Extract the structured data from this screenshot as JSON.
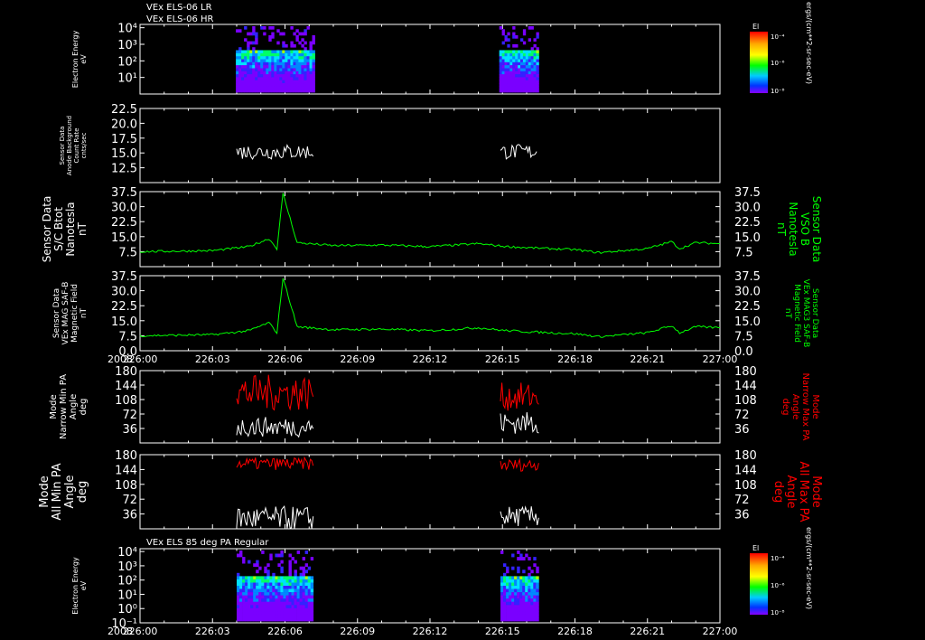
{
  "header": {
    "line1": "VEx ELS-06 LR",
    "line2": "VEx ELS-06 HR",
    "bottom_title": "VEx ELS 85 deg PA Regular"
  },
  "colors": {
    "background": "#000000",
    "axis": "#ffffff",
    "green": "#00ff00",
    "red": "#ff0000"
  },
  "colorbars": [
    {
      "title": "El",
      "ticks": [
        "10⁻⁴",
        "10⁻⁶",
        "10⁻⁸"
      ],
      "unit_label": "ergs/(cm**2-sr-sec-eV)"
    },
    {
      "title": "El",
      "ticks": [
        "10⁻⁴",
        "10⁻⁶",
        "10⁻⁸"
      ],
      "unit_label": "ergs/(cm**2-sr-sec-eV)"
    }
  ],
  "chart_data": [
    {
      "type": "heatmap",
      "ylabel": [
        "Electron Energy",
        "eV"
      ],
      "ytick_labels": [
        "10⁴",
        "10³",
        "10²",
        "10¹"
      ],
      "ylim_log10": [
        0,
        4.2
      ],
      "data_blocks": [
        {
          "x_start": "226:03:58",
          "x_end": "226:07:14"
        },
        {
          "x_start": "226:14:52",
          "x_end": "226:16:30"
        }
      ],
      "zscale": "log"
    },
    {
      "type": "line",
      "ylabel": [
        "Sensor Data",
        "Anode Background",
        "Count Rate",
        "cnts/sec"
      ],
      "ylim": [
        10,
        22.5
      ],
      "yticks": [
        12.5,
        15.0,
        17.5,
        20.0,
        22.5
      ],
      "ytick_labels": [
        "12.5",
        "15.0",
        "17.5",
        "20.0",
        "22.5"
      ],
      "series": [
        {
          "segments": [
            {
              "x_start": "226:04:00",
              "x_end": "226:07:10",
              "level": 15.2,
              "spread": 1.3
            },
            {
              "x_start": "226:14:55",
              "x_end": "226:16:25",
              "level": 15.2,
              "spread": 1.3
            }
          ]
        }
      ]
    },
    {
      "type": "line",
      "ylabel_left": [
        "Sensor Data",
        "S/C Btot",
        "Nanotesla",
        "nT"
      ],
      "ylabel_right": [
        "Sensor Data",
        "VSO B",
        "Nanotesla",
        "nT"
      ],
      "ylim": [
        0,
        37.5
      ],
      "yticks": [
        7.5,
        15.0,
        22.5,
        30.0,
        37.5
      ],
      "ytick_labels": [
        "7.5",
        "15.0",
        "22.5",
        "30.0",
        "37.5"
      ],
      "series": [
        {
          "points": [
            [
              "226:00:00",
              7.5
            ],
            [
              "226:03:00",
              8.0
            ],
            [
              "226:04:30",
              10.0
            ],
            [
              "226:05:20",
              14.0
            ],
            [
              "226:05:40",
              9.0
            ],
            [
              "226:05:55",
              36.5
            ],
            [
              "226:06:30",
              12.0
            ],
            [
              "226:08:00",
              10.5
            ],
            [
              "226:10:00",
              10.8
            ],
            [
              "226:12:00",
              10.0
            ],
            [
              "226:14:00",
              11.5
            ],
            [
              "226:15:00",
              10.2
            ],
            [
              "226:16:00",
              9.5
            ],
            [
              "226:18:00",
              8.5
            ],
            [
              "226:19:00",
              7.0
            ],
            [
              "226:21:00",
              9.0
            ],
            [
              "226:22:00",
              12.5
            ],
            [
              "226:22:20",
              9.0
            ],
            [
              "226:23:00",
              12.0
            ],
            [
              "226:24:00",
              11.5
            ]
          ]
        }
      ]
    },
    {
      "type": "line",
      "ylabel_left": [
        "Sensor Data",
        "VEx MAG SAF-B",
        "Magnetic Field",
        "nT"
      ],
      "ylabel_right": [
        "Sensor Data",
        "VEx MAG3 SAF-B",
        "Magnetic Field",
        "nT"
      ],
      "ylim": [
        0,
        37.5
      ],
      "yticks": [
        0.0,
        7.5,
        15.0,
        22.5,
        30.0,
        37.5
      ],
      "ytick_labels": [
        "0.0",
        "7.5",
        "15.0",
        "22.5",
        "30.0",
        "37.5"
      ],
      "xtick_labels": [
        "226:00",
        "226:03",
        "226:06",
        "226:09",
        "226:12",
        "226:15",
        "226:18",
        "226:21",
        "227:00"
      ],
      "year_label": "2008",
      "series": [
        {
          "points": [
            [
              "226:00:00",
              7.5
            ],
            [
              "226:03:00",
              8.0
            ],
            [
              "226:04:30",
              10.0
            ],
            [
              "226:05:20",
              14.0
            ],
            [
              "226:05:40",
              9.0
            ],
            [
              "226:05:55",
              36.5
            ],
            [
              "226:06:30",
              12.0
            ],
            [
              "226:08:00",
              10.5
            ],
            [
              "226:10:00",
              10.8
            ],
            [
              "226:12:00",
              10.0
            ],
            [
              "226:14:00",
              11.5
            ],
            [
              "226:15:00",
              10.2
            ],
            [
              "226:16:00",
              9.5
            ],
            [
              "226:18:00",
              8.5
            ],
            [
              "226:19:00",
              7.0
            ],
            [
              "226:21:00",
              9.0
            ],
            [
              "226:22:00",
              12.5
            ],
            [
              "226:22:20",
              9.0
            ],
            [
              "226:23:00",
              12.0
            ],
            [
              "226:24:00",
              11.5
            ]
          ]
        }
      ]
    },
    {
      "type": "line",
      "ylabel_left": [
        "Mode",
        "Narrow Min PA",
        "Angle",
        "deg"
      ],
      "ylabel_right": [
        "Mode",
        "Narrow Max PA",
        "Angle",
        "deg"
      ],
      "ylim": [
        0,
        180
      ],
      "yticks": [
        36,
        72,
        108,
        144,
        180
      ],
      "ytick_labels": [
        "36",
        "72",
        "108",
        "144",
        "180"
      ],
      "series": [
        {
          "color": "white",
          "segments": [
            {
              "x_start": "226:04:00",
              "x_end": "226:07:10",
              "level": 40,
              "spread": 25
            },
            {
              "x_start": "226:14:55",
              "x_end": "226:16:30",
              "level": 50,
              "spread": 28
            }
          ]
        },
        {
          "color": "red",
          "segments": [
            {
              "x_start": "226:04:00",
              "x_end": "226:07:10",
              "level": 125,
              "spread": 45
            },
            {
              "x_start": "226:14:55",
              "x_end": "226:16:30",
              "level": 115,
              "spread": 35
            }
          ]
        }
      ]
    },
    {
      "type": "line",
      "ylabel_left": [
        "Mode",
        "All Min PA",
        "Angle",
        "deg"
      ],
      "ylabel_right": [
        "Mode",
        "All Max PA",
        "Angle",
        "deg"
      ],
      "ylim": [
        0,
        180
      ],
      "yticks": [
        36,
        72,
        108,
        144,
        180
      ],
      "ytick_labels": [
        "36",
        "72",
        "108",
        "144",
        "180"
      ],
      "series": [
        {
          "color": "white",
          "segments": [
            {
              "x_start": "226:04:00",
              "x_end": "226:07:10",
              "level": 25,
              "spread": 30
            },
            {
              "x_start": "226:14:55",
              "x_end": "226:16:30",
              "level": 30,
              "spread": 25
            }
          ]
        },
        {
          "color": "red",
          "segments": [
            {
              "x_start": "226:04:00",
              "x_end": "226:07:10",
              "level": 158,
              "spread": 15
            },
            {
              "x_start": "226:14:55",
              "x_end": "226:16:30",
              "level": 155,
              "spread": 15
            }
          ]
        }
      ]
    },
    {
      "type": "heatmap",
      "ylabel": [
        "Electron Energy",
        "eV"
      ],
      "ytick_labels": [
        "10⁴",
        "10³",
        "10²",
        "10¹",
        "10⁰",
        "10⁻¹"
      ],
      "ylim_log10": [
        -1,
        4.2
      ],
      "xtick_labels": [
        "226:00",
        "226:03",
        "226:06",
        "226:09",
        "226:12",
        "226:15",
        "226:18",
        "226:21",
        "227:00"
      ],
      "year_label": "2008",
      "data_blocks": [
        {
          "x_start": "226:04:00",
          "x_end": "226:07:10"
        },
        {
          "x_start": "226:14:55",
          "x_end": "226:16:30"
        }
      ],
      "zscale": "log"
    }
  ]
}
